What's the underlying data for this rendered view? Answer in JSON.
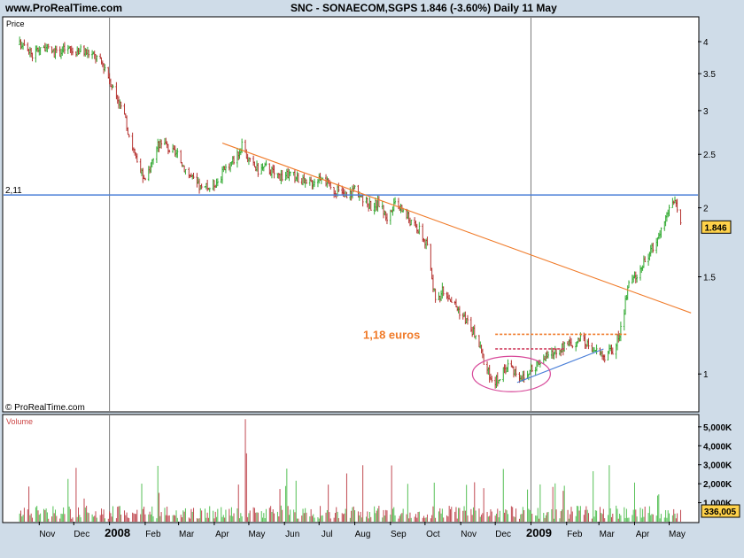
{
  "header": {
    "site": "www.ProRealTime.com",
    "quote": "SNC - SONAECOM,SGPS   1.846 (-3.60%)   Daily  11 May"
  },
  "chart_data": {
    "type": "candlestick",
    "price_panel": {
      "label": "Price",
      "scale": "log",
      "yticks": [
        1,
        1.5,
        2,
        2.5,
        3,
        3.5,
        4
      ],
      "ytick_labels": [
        "1",
        "1.5",
        "2",
        "2.5",
        "3",
        "3.5",
        "4"
      ],
      "horizontal_level": {
        "value": 2.11,
        "label": "2,11",
        "color": "#4a7fd8"
      },
      "last_price": {
        "value": 1.846,
        "label": "1.846",
        "color": "#ffd24a"
      },
      "annotation": {
        "text": "1,18 euros",
        "color": "#f07a28",
        "level": 1.18
      },
      "copyright": "© ProRealTime.com",
      "series_path": [
        [
          "2007-10-15",
          3.95
        ],
        [
          "2007-10-19",
          4.02
        ],
        [
          "2007-10-26",
          3.78
        ],
        [
          "2007-11-02",
          3.92
        ],
        [
          "2007-11-09",
          3.87
        ],
        [
          "2007-11-16",
          3.8
        ],
        [
          "2007-11-23",
          3.88
        ],
        [
          "2007-11-30",
          3.84
        ],
        [
          "2007-12-07",
          3.86
        ],
        [
          "2007-12-14",
          3.82
        ],
        [
          "2007-12-21",
          3.74
        ],
        [
          "2007-12-28",
          3.6
        ],
        [
          "2008-01-04",
          3.3
        ],
        [
          "2008-01-11",
          3.05
        ],
        [
          "2008-01-18",
          2.72
        ],
        [
          "2008-01-25",
          2.4
        ],
        [
          "2008-02-01",
          2.22
        ],
        [
          "2008-02-08",
          2.48
        ],
        [
          "2008-02-15",
          2.66
        ],
        [
          "2008-02-22",
          2.55
        ],
        [
          "2008-02-29",
          2.48
        ],
        [
          "2008-03-07",
          2.35
        ],
        [
          "2008-03-14",
          2.24
        ],
        [
          "2008-03-21",
          2.16
        ],
        [
          "2008-03-28",
          2.18
        ],
        [
          "2008-04-04",
          2.24
        ],
        [
          "2008-04-11",
          2.36
        ],
        [
          "2008-04-18",
          2.45
        ],
        [
          "2008-04-25",
          2.58
        ],
        [
          "2008-05-02",
          2.42
        ],
        [
          "2008-05-09",
          2.34
        ],
        [
          "2008-05-16",
          2.37
        ],
        [
          "2008-05-23",
          2.31
        ],
        [
          "2008-05-30",
          2.28
        ],
        [
          "2008-06-06",
          2.3
        ],
        [
          "2008-06-13",
          2.26
        ],
        [
          "2008-06-20",
          2.2
        ],
        [
          "2008-06-27",
          2.24
        ],
        [
          "2008-07-04",
          2.3
        ],
        [
          "2008-07-11",
          2.16
        ],
        [
          "2008-07-18",
          2.14
        ],
        [
          "2008-07-25",
          2.08
        ],
        [
          "2008-08-01",
          2.18
        ],
        [
          "2008-08-08",
          2.06
        ],
        [
          "2008-08-15",
          2.02
        ],
        [
          "2008-08-22",
          2.04
        ],
        [
          "2008-08-29",
          1.92
        ],
        [
          "2008-09-05",
          2.02
        ],
        [
          "2008-09-12",
          1.98
        ],
        [
          "2008-09-19",
          1.88
        ],
        [
          "2008-09-26",
          1.82
        ],
        [
          "2008-10-03",
          1.7
        ],
        [
          "2008-10-10",
          1.35
        ],
        [
          "2008-10-17",
          1.42
        ],
        [
          "2008-10-24",
          1.36
        ],
        [
          "2008-10-31",
          1.3
        ],
        [
          "2008-11-07",
          1.24
        ],
        [
          "2008-11-14",
          1.17
        ],
        [
          "2008-11-21",
          1.06
        ],
        [
          "2008-11-28",
          0.96
        ],
        [
          "2008-12-05",
          0.99
        ],
        [
          "2008-12-12",
          1.04
        ],
        [
          "2008-12-19",
          1.01
        ],
        [
          "2008-12-26",
          0.98
        ],
        [
          "2009-01-02",
          1.02
        ],
        [
          "2009-01-09",
          1.06
        ],
        [
          "2009-01-16",
          1.08
        ],
        [
          "2009-01-23",
          1.1
        ],
        [
          "2009-01-30",
          1.12
        ],
        [
          "2009-02-06",
          1.14
        ],
        [
          "2009-02-13",
          1.15
        ],
        [
          "2009-02-20",
          1.13
        ],
        [
          "2009-02-27",
          1.1
        ],
        [
          "2009-03-06",
          1.08
        ],
        [
          "2009-03-13",
          1.1
        ],
        [
          "2009-03-20",
          1.2
        ],
        [
          "2009-03-27",
          1.45
        ],
        [
          "2009-04-03",
          1.52
        ],
        [
          "2009-04-10",
          1.6
        ],
        [
          "2009-04-17",
          1.7
        ],
        [
          "2009-04-24",
          1.82
        ],
        [
          "2009-05-01",
          2.0
        ],
        [
          "2009-05-06",
          2.08
        ],
        [
          "2009-05-11",
          1.846
        ]
      ],
      "trendlines": [
        {
          "from": [
            "2008-04-08",
            2.62
          ],
          "to": [
            "2009-05-20",
            1.29
          ],
          "color": "#f07a28"
        },
        {
          "from": [
            "2008-12-20",
            0.965
          ],
          "to": [
            "2009-03-05",
            1.11
          ],
          "color": "#4a7fd8"
        },
        {
          "from": [
            "2008-12-01",
            1.18
          ],
          "to": [
            "2009-03-25",
            1.18
          ],
          "color": "#f07a28",
          "style": "dotted"
        },
        {
          "from": [
            "2008-12-01",
            1.11
          ],
          "to": [
            "2009-02-01",
            1.11
          ],
          "color": "#d04060",
          "style": "dotted"
        }
      ],
      "ellipse": {
        "center": [
          "2008-12-15",
          1.0
        ],
        "color": "#d84a9a"
      }
    },
    "volume_panel": {
      "label": "Volume",
      "yticks": [
        1000,
        2000,
        3000,
        4000,
        5000
      ],
      "ytick_labels": [
        "1,000K",
        "2,000K",
        "3,000K",
        "4,000K",
        "5,000K"
      ],
      "ymax": 5600,
      "last_volume": {
        "value": 336.005,
        "label": "336,005"
      }
    },
    "x_axis": {
      "start": "2007-10-01",
      "end": "2009-05-26",
      "ticks": [
        {
          "date": "2007-11-01",
          "label": "Nov"
        },
        {
          "date": "2007-12-01",
          "label": "Dec"
        },
        {
          "date": "2008-01-01",
          "label": "2008",
          "major": true
        },
        {
          "date": "2008-02-01",
          "label": "Feb"
        },
        {
          "date": "2008-03-01",
          "label": "Mar"
        },
        {
          "date": "2008-04-01",
          "label": "Apr"
        },
        {
          "date": "2008-05-01",
          "label": "May"
        },
        {
          "date": "2008-06-01",
          "label": "Jun"
        },
        {
          "date": "2008-07-01",
          "label": "Jul"
        },
        {
          "date": "2008-08-01",
          "label": "Aug"
        },
        {
          "date": "2008-09-01",
          "label": "Sep"
        },
        {
          "date": "2008-10-01",
          "label": "Oct"
        },
        {
          "date": "2008-11-01",
          "label": "Nov"
        },
        {
          "date": "2008-12-01",
          "label": "Dec"
        },
        {
          "date": "2009-01-01",
          "label": "2009",
          "major": true
        },
        {
          "date": "2009-02-01",
          "label": "Feb"
        },
        {
          "date": "2009-03-01",
          "label": "Mar"
        },
        {
          "date": "2009-04-01",
          "label": "Apr"
        },
        {
          "date": "2009-05-01",
          "label": "May"
        }
      ]
    },
    "colors": {
      "up": "#33aa33",
      "down": "#b5322f",
      "grid": "#7a7a7a",
      "volume_up": "#55c055",
      "volume_down": "#c04a52"
    }
  }
}
